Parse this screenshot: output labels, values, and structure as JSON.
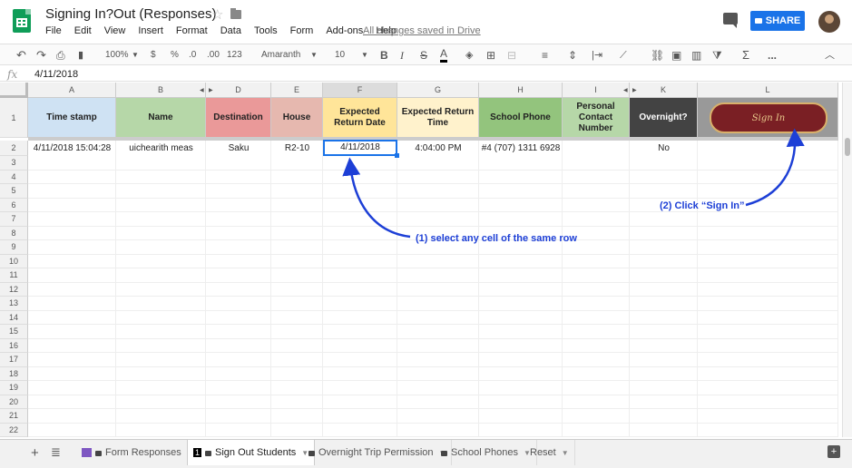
{
  "doc": {
    "title": "Signing In?Out (Responses)",
    "saved": "All changes saved in Drive"
  },
  "menu": [
    "File",
    "Edit",
    "View",
    "Insert",
    "Format",
    "Data",
    "Tools",
    "Form",
    "Add-ons",
    "Help"
  ],
  "share_label": "SHARE",
  "toolbar": {
    "zoom": "100%",
    "currency": "$",
    "percent": "%",
    "dec_less": ".0",
    "dec_more": ".00",
    "format_more": "123",
    "font": "Amaranth",
    "size": "10",
    "bold": "B",
    "italic": "I",
    "strike": "S",
    "textcolor": "A",
    "more": "..."
  },
  "formula": {
    "fx": "fx",
    "value": "4/11/2018"
  },
  "columns": [
    "A",
    "B",
    "D",
    "E",
    "F",
    "G",
    "H",
    "I",
    "K",
    "L"
  ],
  "headers": [
    "Time stamp",
    "Name",
    "Destination",
    "House",
    "Expected Return Date",
    "Expected Return Time",
    "School Phone",
    "Personal Contact Number",
    "Overnight?"
  ],
  "header_colors": [
    "#cfe2f3",
    "#b6d7a8",
    "#ea9999",
    "#e6b8af",
    "#ffe599",
    "#fff2cc",
    "#93c47d",
    "#b6d7a8",
    "#434343"
  ],
  "row2": [
    "4/11/2018 15:04:28",
    "uichearith meas",
    "Saku",
    "R2-10",
    "4/11/2018",
    "4:04:00 PM",
    "#4 (707) 1311 6928",
    "",
    "No"
  ],
  "rows": [
    "1",
    "2",
    "3",
    "4",
    "5",
    "6",
    "7",
    "8",
    "9",
    "10",
    "11",
    "12",
    "13",
    "14",
    "15",
    "16",
    "17",
    "18",
    "19",
    "20",
    "21",
    "22"
  ],
  "sign_in_label": "Sign In",
  "annotations": {
    "step1": "(1) select any cell of the same row",
    "step2": "(2) Click “Sign In”"
  },
  "tabs": [
    {
      "label": "Form Responses"
    },
    {
      "label": "Sign Out Students",
      "badge": "1"
    },
    {
      "label": "Overnight Trip Permission"
    },
    {
      "label": "School Phones"
    },
    {
      "label": "Reset"
    }
  ],
  "colors": {
    "accent": "#1a73e8",
    "annotation": "#1d3fd6"
  }
}
